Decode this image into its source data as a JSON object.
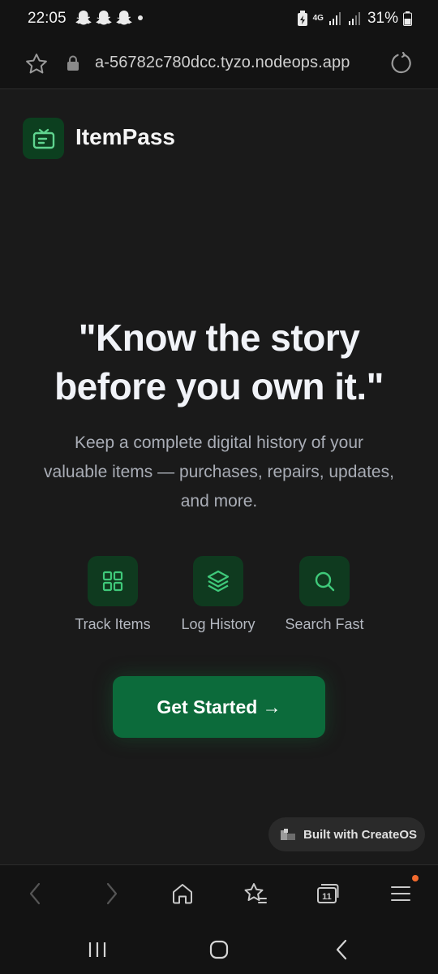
{
  "status_bar": {
    "time": "22:05",
    "notification_icons": [
      "snapchat-icon",
      "snapchat-icon",
      "snapchat-icon"
    ],
    "network": "4G",
    "battery": "31%"
  },
  "url_bar": {
    "url": "a-56782c780dcc.tyzo.nodeops.app"
  },
  "app": {
    "name": "ItemPass"
  },
  "hero": {
    "title_line1": "\"Know the story",
    "title_line2": "before you own it.\"",
    "subtitle": "Keep a complete digital history of your valuable items — purchases, repairs, updates, and more."
  },
  "features": [
    {
      "label": "Track Items",
      "icon": "grid-icon"
    },
    {
      "label": "Log History",
      "icon": "layers-icon"
    },
    {
      "label": "Search Fast",
      "icon": "search-icon"
    }
  ],
  "cta": {
    "label": "Get Started →"
  },
  "badge": {
    "label": "Built with CreateOS"
  },
  "colors": {
    "background": "#1a1a1a",
    "accent": "#0c6b3b",
    "icon_accent": "#3fc97a",
    "notification": "#f26a2e"
  },
  "toolbar": {
    "tab_count": "11"
  }
}
